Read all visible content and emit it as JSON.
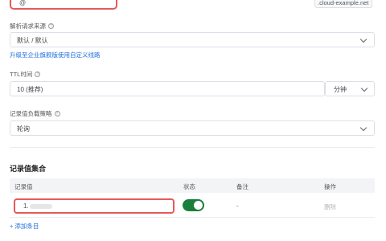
{
  "host": {
    "value": "@",
    "suffix": ".cloud-example.net"
  },
  "source": {
    "label": "解析请求来源",
    "value": "默认 / 默认",
    "upgrade_link": "升级至企业旗舰版使用自定义线路"
  },
  "ttl": {
    "label": "TTL时间",
    "value": "10 (推荐)",
    "unit": "分钟"
  },
  "lb": {
    "label": "记录值负载策略",
    "value": "轮询"
  },
  "records": {
    "title": "记录值集合",
    "columns": [
      "记录值",
      "状态",
      "备注",
      "操作"
    ],
    "rows": [
      {
        "value": "1.",
        "enabled": true,
        "remark": "-",
        "action": "删除"
      }
    ],
    "add_label": "添加条目"
  },
  "colors": {
    "accent": "#1f6fdb",
    "toggle_on": "#1a7f3c",
    "highlight": "#e65a5a"
  }
}
